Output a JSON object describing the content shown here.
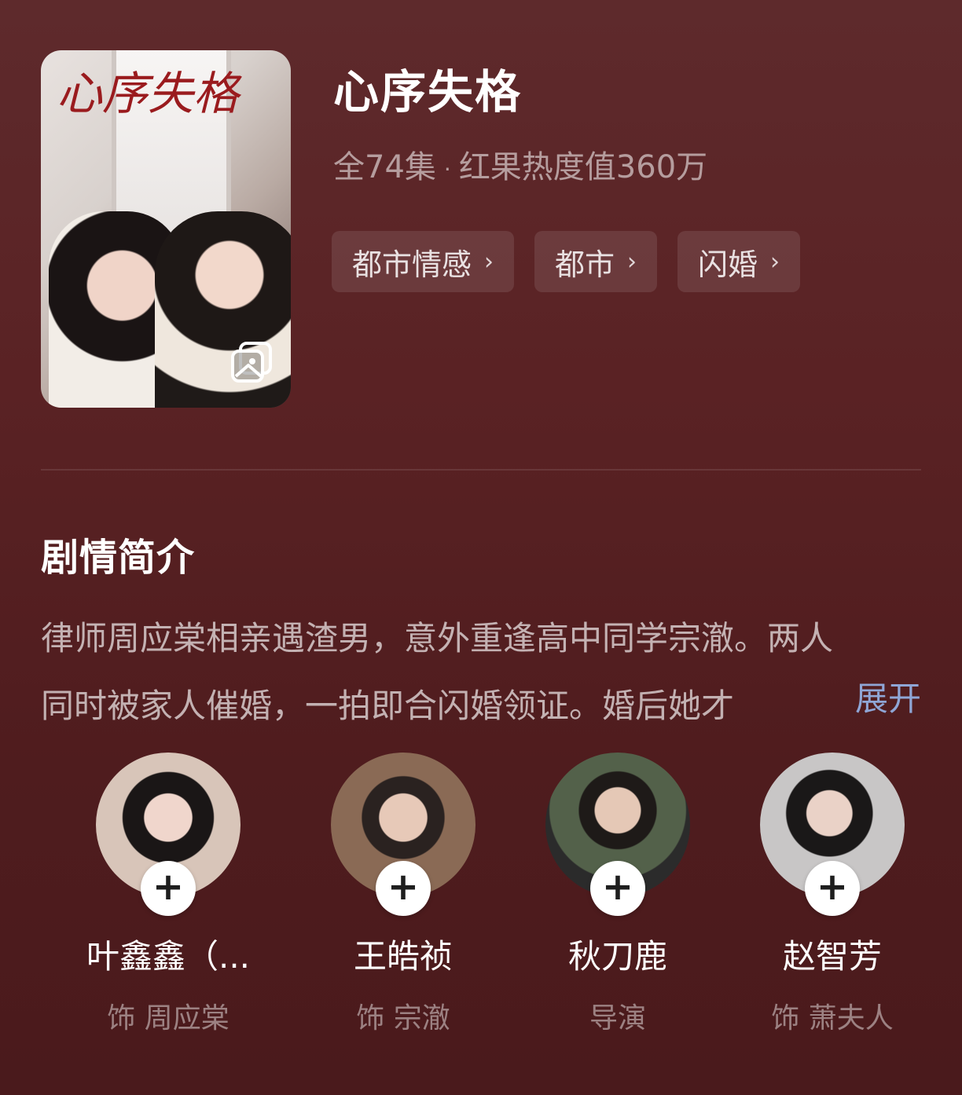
{
  "drama": {
    "title": "心序失格",
    "episodes": "全74集",
    "separator": "·",
    "heat": "红果热度值360万",
    "poster_title": "心序失格"
  },
  "tags": [
    {
      "label": "都市情感",
      "chevron": "›"
    },
    {
      "label": "都市",
      "chevron": "›"
    },
    {
      "label": "闪婚",
      "chevron": "›"
    }
  ],
  "synopsis": {
    "heading": "剧情简介",
    "line1": "律师周应棠相亲遇渣男，意外重逢高中同学宗澈。两人",
    "line2": "同时被家人催婚，一拍即合闪婚领证。婚后她才",
    "expand": "展开"
  },
  "cast": [
    {
      "name": "叶鑫鑫（...",
      "role": "饰 周应棠",
      "plus": "+"
    },
    {
      "name": "王皓祯",
      "role": "饰 宗澈",
      "plus": "+"
    },
    {
      "name": "秋刀鹿",
      "role": "导演",
      "plus": "+"
    },
    {
      "name": "赵智芳",
      "role": "饰 萧夫人",
      "plus": "+"
    }
  ],
  "icons": {
    "gallery": "gallery-icon",
    "follow": "plus-icon"
  }
}
